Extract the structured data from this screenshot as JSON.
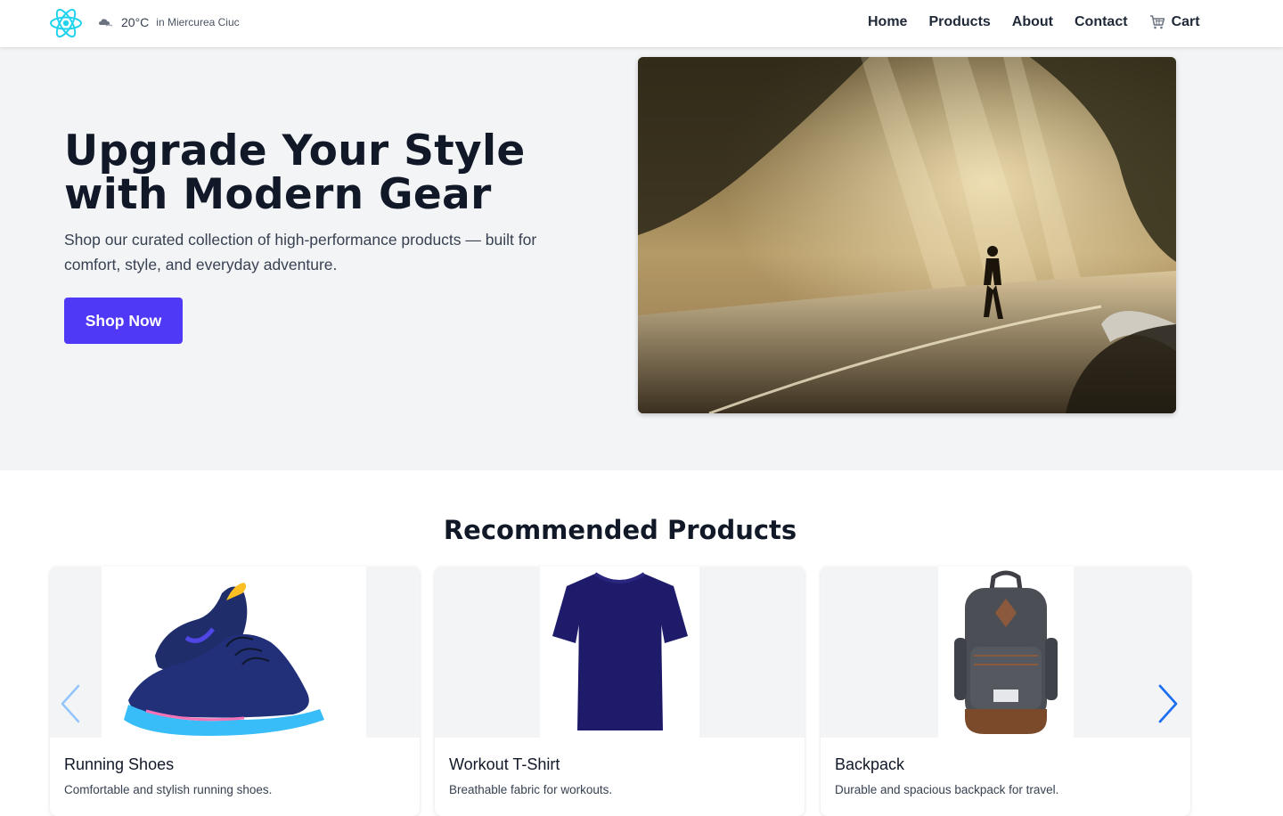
{
  "weather": {
    "temperature": "20°C",
    "location": "in Miercurea Ciuc",
    "icon": "cloud-icon"
  },
  "nav": {
    "items": [
      {
        "label": "Home"
      },
      {
        "label": "Products"
      },
      {
        "label": "About"
      },
      {
        "label": "Contact"
      }
    ],
    "cart_label": "Cart"
  },
  "hero": {
    "title": "Upgrade Your Style with Modern Gear",
    "subtitle": "Shop our curated collection of high-performance products — built for comfort, style, and everyday adventure.",
    "cta_label": "Shop Now"
  },
  "recommended": {
    "title": "Recommended Products",
    "products": [
      {
        "name": "Running Shoes",
        "description": "Comfortable and stylish running shoes."
      },
      {
        "name": "Workout T-Shirt",
        "description": "Breathable fabric for workouts."
      },
      {
        "name": "Backpack",
        "description": "Durable and spacious backpack for travel."
      }
    ]
  },
  "colors": {
    "accent": "#4f39f6",
    "logo": "#22d3ee",
    "arrow": "#3b82f6"
  }
}
